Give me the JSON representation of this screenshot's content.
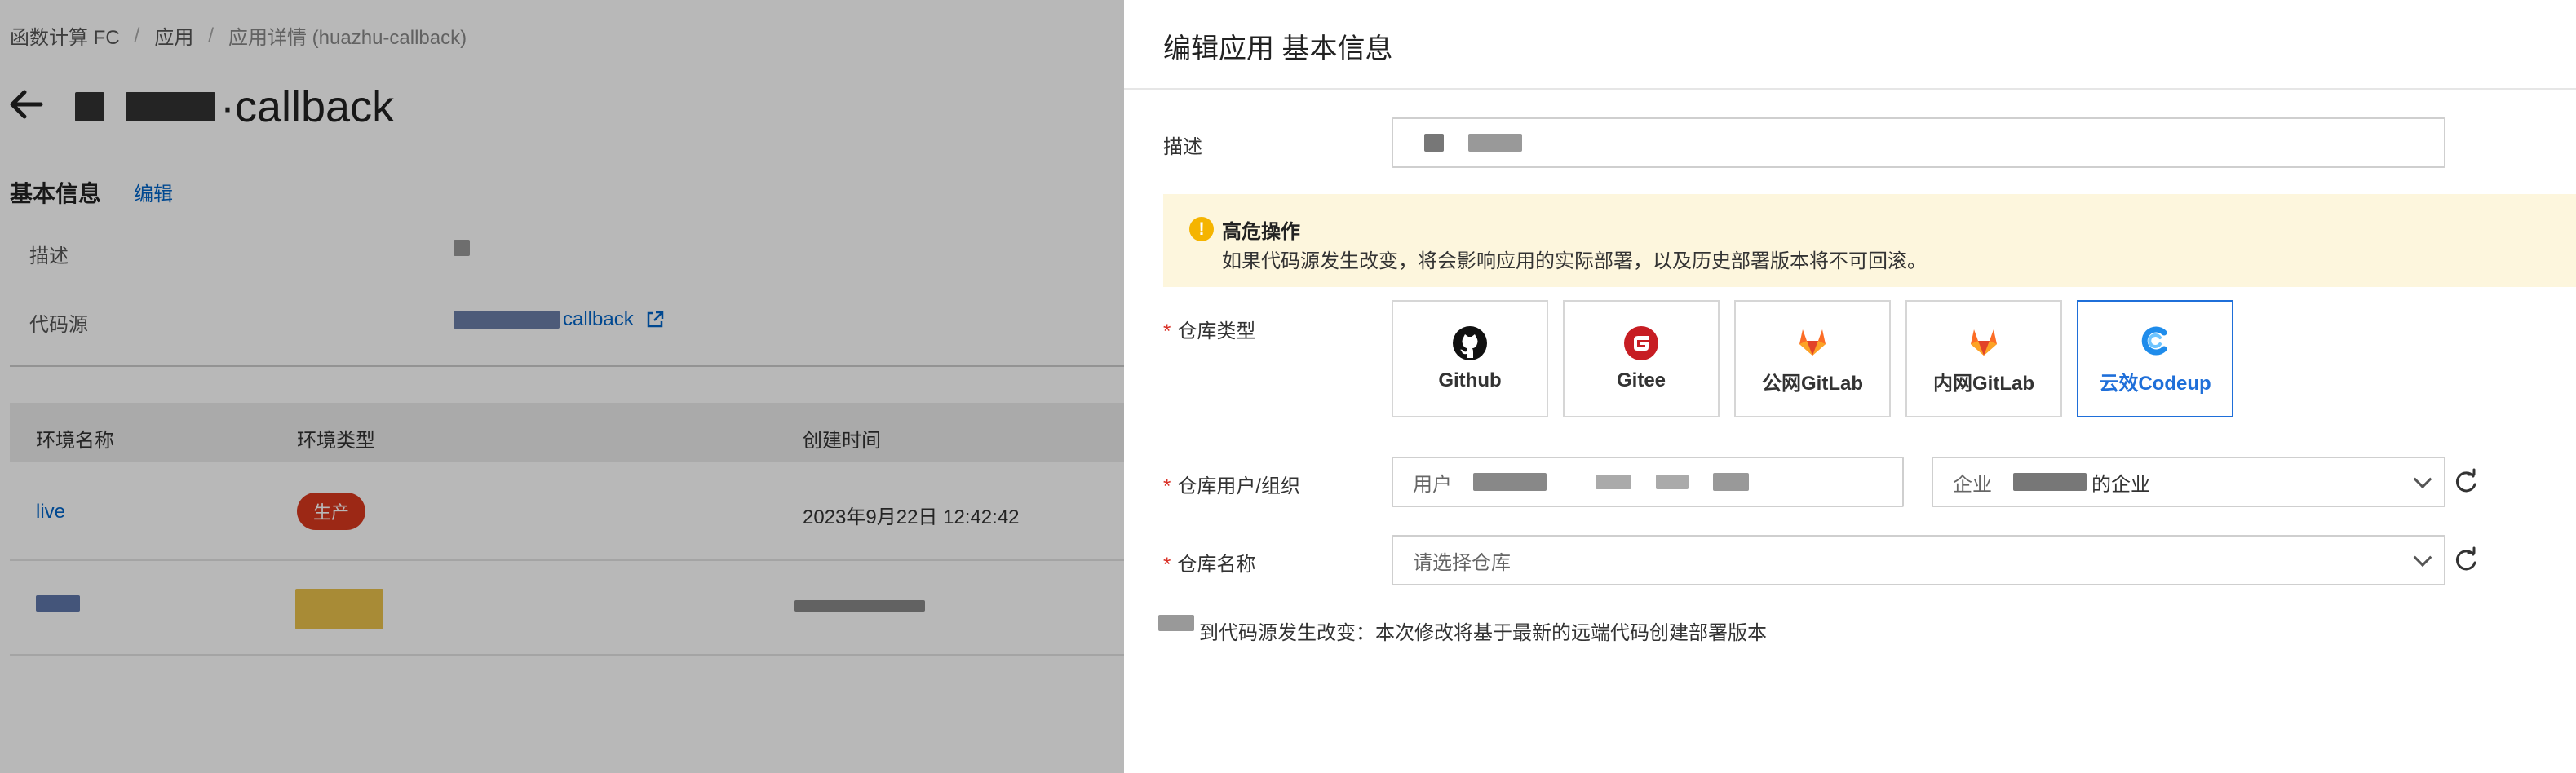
{
  "breadcrumb": {
    "items": [
      "函数计算 FC",
      "应用",
      "应用详情 (huazhu-callback)"
    ]
  },
  "app": {
    "title_suffix": "·callback"
  },
  "basic_info": {
    "title": "基本信息",
    "edit_label": "编辑",
    "fields": [
      {
        "label": "描述",
        "value": ""
      },
      {
        "label": "代码源",
        "value": "callback"
      }
    ]
  },
  "env_table": {
    "headers": [
      "环境名称",
      "环境类型",
      "创建时间"
    ],
    "rows": [
      {
        "name": "live",
        "type": "生产",
        "created": "2023年9月22日 12:42:42"
      }
    ]
  },
  "drawer": {
    "title": "编辑应用 基本信息",
    "desc_label": "描述",
    "warning": {
      "title": "高危操作",
      "text": "如果代码源发生改变，将会影响应用的实际部署，以及历史部署版本将不可回滚。"
    },
    "repo_type_label": "仓库类型",
    "repo_types": [
      {
        "name": "Github",
        "icon": "github-icon"
      },
      {
        "name": "Gitee",
        "icon": "gitee-icon"
      },
      {
        "name": "公网GitLab",
        "icon": "gitlab-icon"
      },
      {
        "name": "内网GitLab",
        "icon": "gitlab-icon"
      },
      {
        "name": "云效Codeup",
        "icon": "codeup-icon",
        "selected": true
      }
    ],
    "repo_owner_label": "仓库用户/组织",
    "user_prefix": "用户",
    "org_prefix": "企业",
    "org_suffix": "的企业",
    "repo_name_label": "仓库名称",
    "repo_name_placeholder": "请选择仓库",
    "change_note": "到代码源发生改变：本次修改将基于最新的远端代码创建部署版本"
  },
  "colors": {
    "accent": "#1f6fd9",
    "danger": "#d93026",
    "warning_bg": "#fdf6dd",
    "link": "#0064c8"
  }
}
